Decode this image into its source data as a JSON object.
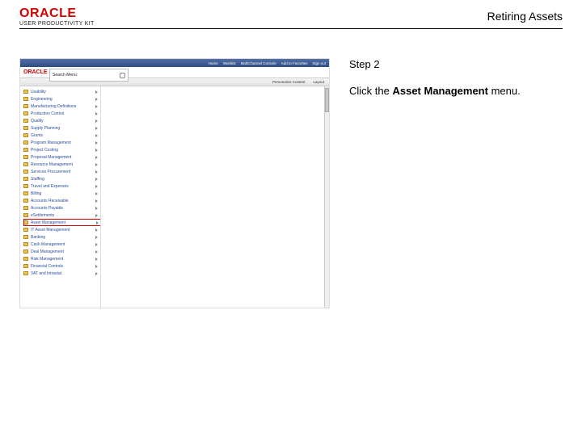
{
  "header": {
    "oracle": "ORACLE",
    "upk": "USER PRODUCTIVITY KIT",
    "doc_title": "Retiring Assets"
  },
  "instruction": {
    "step_label": "Step 2",
    "prefix": "Click the ",
    "bold": "Asset Management",
    "suffix": " menu."
  },
  "shot": {
    "topbar": {
      "left": "",
      "home": "Home",
      "worklist": "Worklist",
      "mcc": "MultiChannel Console",
      "atf": "Add to Favorites",
      "signout": "Sign out"
    },
    "logo": "ORACLE",
    "search": {
      "label": "Search Menu:"
    },
    "subhead": {
      "personalize": "Personalize Content",
      "layout": "Layout"
    },
    "menu": [
      "Usability",
      "Engineering",
      "Manufacturing Definitions",
      "Production Control",
      "Quality",
      "Supply Planning",
      "Grants",
      "Program Management",
      "Project Costing",
      "Proposal Management",
      "Resource Management",
      "Services Procurement",
      "Staffing",
      "Travel and Expenses",
      "Billing",
      "Accounts Receivable",
      "Accounts Payable",
      "eSettlements",
      "Asset Management",
      "IT Asset Management",
      "Banking",
      "Cash Management",
      "Deal Management",
      "Risk Management",
      "Financial Controls",
      "VAT and Intrastat"
    ],
    "highlight_index": 18
  }
}
